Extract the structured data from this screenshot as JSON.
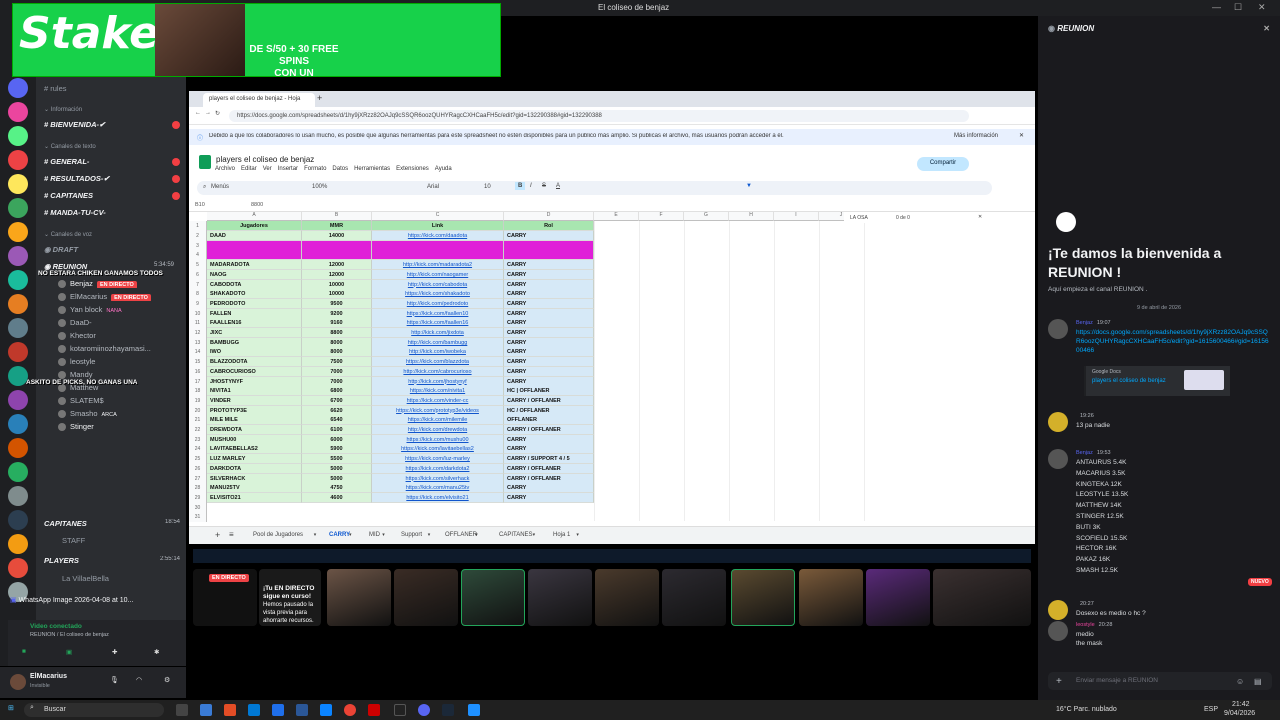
{
  "window": {
    "title": "El coliseo de benjaz"
  },
  "ad": {
    "brand": "Stake",
    "promo_line1": "DE S/50 + 30 FREE SPINS",
    "promo_line2": "CON UN DEPOSITO DE S/50"
  },
  "channels": [
    {
      "label": "rules",
      "style": "grey"
    },
    {
      "label": "Información",
      "style": "cat"
    },
    {
      "label": "BIENVENIDA-✔",
      "style": "big"
    },
    {
      "label": "Canales de texto",
      "style": "cat"
    },
    {
      "label": "GENERAL-",
      "style": "big"
    },
    {
      "label": "RESULTADOS-✔",
      "style": "big"
    },
    {
      "label": "CAPITANES",
      "style": "big"
    },
    {
      "label": "MANDA-TU-CV-",
      "style": "big"
    },
    {
      "label": "Canales de voz",
      "style": "cat"
    },
    {
      "label": "DRAFT",
      "style": "big-grey"
    },
    {
      "label": "REUNION",
      "style": "big"
    }
  ],
  "voice_users": [
    "Benjaz",
    "ElMacarius",
    "Yan block",
    "DaaD-",
    "Khector",
    "kotaromiinozhayamasi...",
    "leostyle",
    "Mandy",
    "Matthew",
    "SLATEM$",
    "Smasho",
    "Stinger"
  ],
  "voice_tags": {
    "live": "EN DIRECTO",
    "nana": "NANA",
    "arca": "ARCA"
  },
  "voice_time": "5:34:59",
  "overlay_text": {
    "line1": "NO ESTARA CHIKEN GANAMOS TODOS",
    "line2": "ASKITO DE PICKS, NO GANAS UNA"
  },
  "lower_channels": [
    {
      "label": "CAPITANES",
      "time": "18:54"
    },
    {
      "label": "STAFF",
      "time": ""
    },
    {
      "label": "PLAYERS",
      "time": "2:55:14"
    },
    {
      "label": "La VillaelBella",
      "time": ""
    }
  ],
  "whatsapp_label": "WhatsApp Image 2026-04-08 at 10...",
  "voice_conn": {
    "status": "Video conectado",
    "where": "REUNION / El coliseo de benjaz"
  },
  "user": {
    "name": "ElMacarius",
    "status": "Invisible"
  },
  "browser": {
    "tab_title": "players el coliseo de benjaz - Hoja",
    "url": "https://docs.google.com/spreadsheets/d/1hy9jXRzz82OAJq9cSSQR6oozQUHYRagcCXHCaaFH5c/edit?gid=132290388#gid=132290388",
    "notice": "Debido a que los colaboradores lo usan mucho, es posible que algunas herramientas para este spreadsheet no estén disponibles para un público más amplio. Si publicas el archivo, más usuarios podrán acceder a él.",
    "notice_link": "Más información",
    "doc_title": "players el coliseo de benjaz",
    "menus": [
      "Archivo",
      "Editar",
      "Ver",
      "Insertar",
      "Formato",
      "Datos",
      "Herramientas",
      "Extensiones",
      "Ayuda"
    ],
    "share_label": "Compartir",
    "menus_search": "Menús",
    "zoom": "100%",
    "font": "Arial",
    "font_size": "10",
    "cell_ref": "B10",
    "cell_value": "8800",
    "find": {
      "text": "LA OSA",
      "count": "0 de 0"
    }
  },
  "sheet": {
    "col_letters": [
      "A",
      "B",
      "C",
      "D",
      "E",
      "F",
      "G",
      "H",
      "I",
      "J",
      "K"
    ],
    "headers": [
      "Jugadores",
      "MMR",
      "Link",
      "Rol"
    ],
    "rows": [
      {
        "n": "2",
        "name": "DAAD",
        "mmr": "14000",
        "link": "https://kick.com/daadota",
        "rol": "CARRY"
      },
      {
        "n": "3",
        "name": "",
        "mmr": "",
        "link": "",
        "rol": "",
        "magenta": true
      },
      {
        "n": "4",
        "name": "",
        "mmr": "",
        "link": "",
        "rol": "",
        "magenta": true
      },
      {
        "n": "5",
        "name": "MADARADOTA",
        "mmr": "12000",
        "link": "http://kick.com/madaradota2",
        "rol": "CARRY"
      },
      {
        "n": "6",
        "name": "NAOG",
        "mmr": "12000",
        "link": "http://kick.com/naogamer",
        "rol": "CARRY"
      },
      {
        "n": "7",
        "name": "CABODOTA",
        "mmr": "10000",
        "link": "http://kick.com/cabodota",
        "rol": "CARRY"
      },
      {
        "n": "8",
        "name": "SHAKADOTO",
        "mmr": "10000",
        "link": "https://kick.com/shakadoto",
        "rol": "CARRY"
      },
      {
        "n": "9",
        "name": "PEDRODOTO",
        "mmr": "9500",
        "link": "http://kick.com/pedrodoto",
        "rol": "CARRY"
      },
      {
        "n": "10",
        "name": "FALLEN",
        "mmr": "9200",
        "link": "https://kick.com/faallen10",
        "rol": "CARRY"
      },
      {
        "n": "11",
        "name": "FAALLEN16",
        "mmr": "9160",
        "link": "https://kick.com/faallen16",
        "rol": "CARRY"
      },
      {
        "n": "12",
        "name": "JIXC",
        "mmr": "8800",
        "link": "http://kick.com/jixdota",
        "rol": "CARRY"
      },
      {
        "n": "13",
        "name": "BAMBUGG",
        "mmr": "8000",
        "link": "http://kick.com/bambugg",
        "rol": "CARRY"
      },
      {
        "n": "14",
        "name": "IWO",
        "mmr": "8000",
        "link": "http://kick.com/iwobeka",
        "rol": "CARRY"
      },
      {
        "n": "15",
        "name": "BLAZZODOTA",
        "mmr": "7500",
        "link": "https://kick.com/blazzdota",
        "rol": "CARRY"
      },
      {
        "n": "16",
        "name": "CABROCURIOSO",
        "mmr": "7000",
        "link": "http://kick.com/cabrocurioso",
        "rol": "CARRY"
      },
      {
        "n": "17",
        "name": "JHOSTYNYF",
        "mmr": "7000",
        "link": "http://kick.com/jhostynyf",
        "rol": "CARRY"
      },
      {
        "n": "18",
        "name": "NIVITA1",
        "mmr": "6800",
        "link": "https://kick.com/nivita1",
        "rol": "HC | OFFLANER"
      },
      {
        "n": "19",
        "name": "VINDER",
        "mmr": "6700",
        "link": "https://kick.com/vinder-cc",
        "rol": "CARRY / OFFLANER"
      },
      {
        "n": "20",
        "name": "PROTOTYP3E",
        "mmr": "6620",
        "link": "https://kick.com/prototyp3e/videos",
        "rol": "HC / OFFLANER"
      },
      {
        "n": "21",
        "name": "MILE MILE",
        "mmr": "6540",
        "link": "https://kick.com/milemile",
        "rol": "OFFLANER"
      },
      {
        "n": "22",
        "name": "DREWDOTA",
        "mmr": "6100",
        "link": "http://kick.com/drewdota",
        "rol": "CARRY / OFFLANER"
      },
      {
        "n": "23",
        "name": "MUSHU00",
        "mmr": "6000",
        "link": "https://kick.com/mushu00",
        "rol": "CARRY"
      },
      {
        "n": "24",
        "name": "LAVITAEBELLAS2",
        "mmr": "5900",
        "link": "https://kick.com/lavitaebellas2",
        "rol": "CARRY"
      },
      {
        "n": "25",
        "name": "LUZ MARLEY",
        "mmr": "5500",
        "link": "https://kick.com/luz-marley",
        "rol": "CARRY / SUPPORT 4 / 5"
      },
      {
        "n": "26",
        "name": "DARKDOTA",
        "mmr": "5000",
        "link": "https://kick.com/darkdota2",
        "rol": "CARRY / OFFLANER"
      },
      {
        "n": "27",
        "name": "SILVERHACK",
        "mmr": "5000",
        "link": "https://kick.com/silverhack",
        "rol": "CARRY / OFFLANER"
      },
      {
        "n": "28",
        "name": "MANU25TV",
        "mmr": "4750",
        "link": "https://kick.com/manu25tv",
        "rol": "CARRY"
      },
      {
        "n": "29",
        "name": "ELVISITO21",
        "mmr": "4600",
        "link": "https://kick.com/elvisito21",
        "rol": "CARRY"
      },
      {
        "n": "30",
        "name": "",
        "mmr": "",
        "link": "",
        "rol": ""
      },
      {
        "n": "31",
        "name": "",
        "mmr": "",
        "link": "",
        "rol": ""
      }
    ],
    "tabs": [
      "Pool de Jugadores",
      "CARRY",
      "MID",
      "Support",
      "OFFLANER",
      "CAPITANES",
      "Hoja 1"
    ],
    "active_tab": "CARRY"
  },
  "stream": {
    "live_badge": "EN DIRECTO",
    "paused_title": "¡Tu EN DIRECTO sigue en curso!",
    "paused_body": "Hemos pausado la vista previa para ahorrarte recursos."
  },
  "chat": {
    "channel": "REUNION",
    "welcome": "¡Te damos la bienvenida a REUNION !",
    "welcome_sub": "Aquí empieza el canal REUNION .",
    "date": "9 de abril de 2026",
    "messages": [
      {
        "author": "Benjaz",
        "time": "19:07",
        "text": "https://docs.google.com/spreadsheets/d/1hy9jXRzz82OAJq9cSSQR6oozQUHYRagcCXHCaaFH5c/edit?gid=1615600466#gid=1615600466",
        "link": true
      },
      {
        "author": "",
        "time": "19:26",
        "text": "13 pa nadie",
        "link": false
      },
      {
        "author": "Benjaz",
        "time": "19:53",
        "text": "ANTAURUS 5.4K\nMACARIUS 3.5K\nKINGTEKA 12K\nLEOSTYLE 13.5K\nMATTHEW 14K\nSTINGER 12.5K\nBUTI 3K\nSCOFIELD 15.5K\nHECTOR 16K\nPAKAZ 16K\nSMASH 12.5K",
        "link": false
      },
      {
        "author": "",
        "time": "20:27",
        "text": "Dosexo es medio o hc ?",
        "link": false
      },
      {
        "author": "leostyle",
        "time": "20:28",
        "text": "medio\nthe mask",
        "link": false
      }
    ],
    "embed_provider": "Google Docs",
    "embed_title": "players el coliseo de benjaz",
    "new_badge": "NUEVO",
    "input_placeholder": "Enviar mensaje a REUNION"
  },
  "taskbar": {
    "search": "Buscar",
    "weather": "16°C  Parc. nublado",
    "lang": "ESP",
    "time": "21:42",
    "date": "9/04/2026"
  }
}
